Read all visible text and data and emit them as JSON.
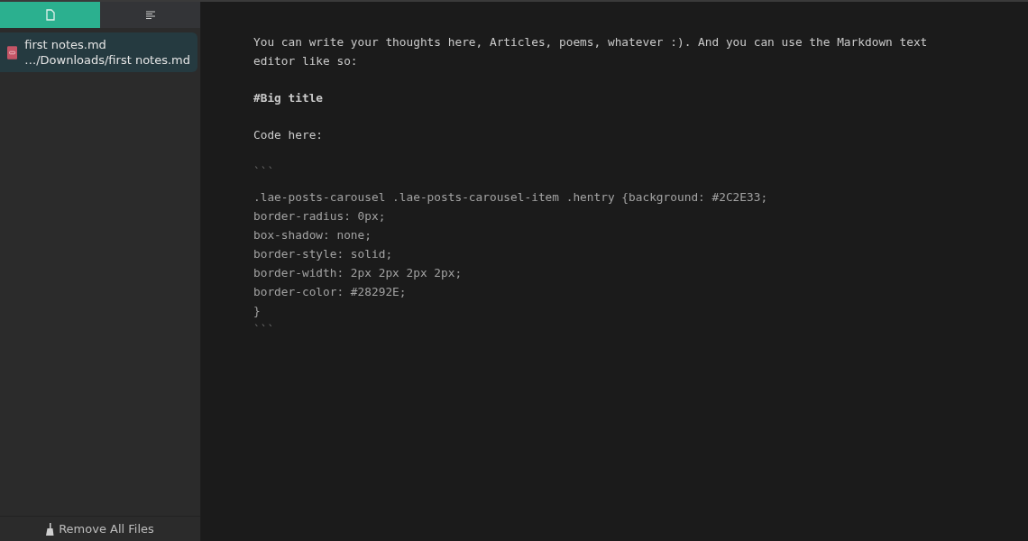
{
  "sidebar": {
    "tabs": [
      {
        "kind": "files",
        "selected": true
      },
      {
        "kind": "outline",
        "selected": false
      }
    ],
    "files": [
      {
        "name": "first notes.md",
        "path": "…/Downloads/first notes.md",
        "selected": true
      }
    ],
    "footer_button": "Remove All Files"
  },
  "editor": {
    "blocks": [
      {
        "kind": "text",
        "text": "You can write your thoughts here, Articles, poems, whatever :). And you can use the Markdown text editor like so:"
      },
      {
        "kind": "heading",
        "text": "#Big title"
      },
      {
        "kind": "text",
        "text": "Code here:"
      },
      {
        "kind": "fence",
        "text": "```"
      },
      {
        "kind": "code",
        "lines": [
          ".lae-posts-carousel .lae-posts-carousel-item .hentry {background: #2C2E33;",
          "border-radius: 0px;",
          "box-shadow: none;",
          "border-style: solid;",
          "border-width: 2px 2px 2px 2px;",
          "border-color: #28292E;",
          "}"
        ]
      },
      {
        "kind": "fence",
        "text": "```"
      }
    ]
  }
}
